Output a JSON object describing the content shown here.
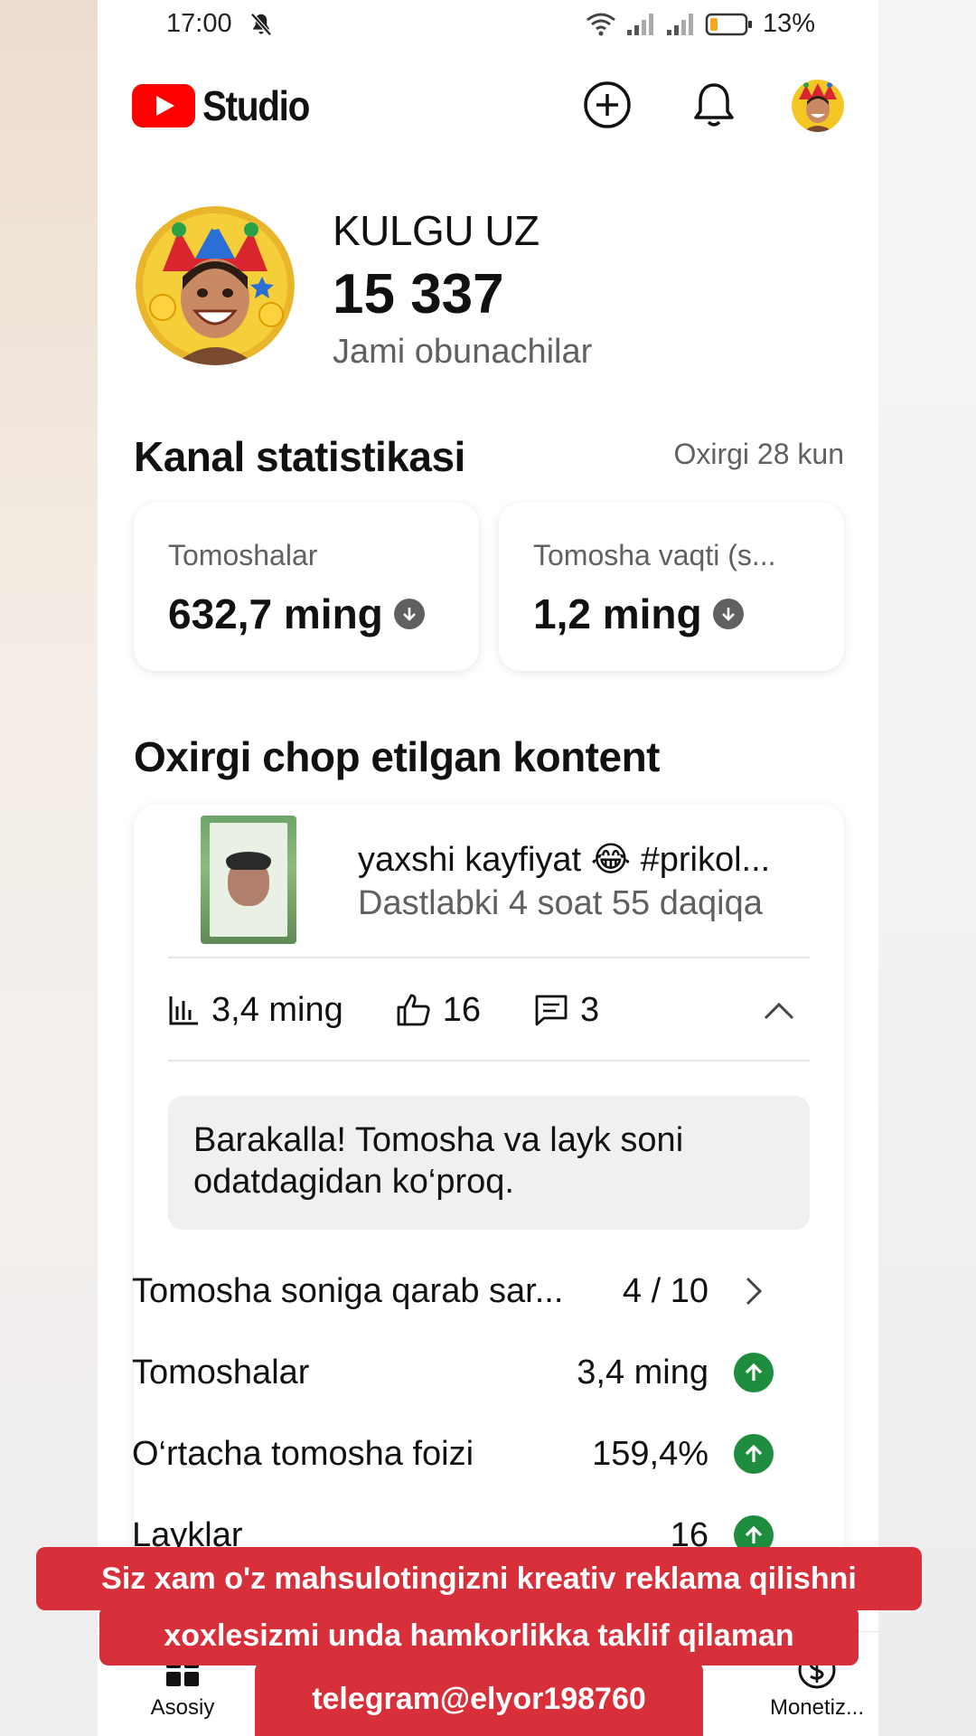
{
  "status_bar": {
    "time": "17:00",
    "battery_percent": "13%",
    "icons": [
      "mute-icon",
      "wifi-icon",
      "signal-icon",
      "signal-icon",
      "battery-icon"
    ]
  },
  "app_bar": {
    "logo_text": "Studio",
    "actions": [
      "create-icon",
      "bell-icon",
      "avatar"
    ]
  },
  "channel": {
    "name": "KULGU UZ",
    "subscribers": "15 337",
    "subscribers_label": "Jami obunachilar"
  },
  "stats": {
    "title": "Kanal statistikasi",
    "period": "Oxirgi 28 kun",
    "cards": [
      {
        "label": "Tomoshalar",
        "value": "632,7 ming",
        "trend": "down"
      },
      {
        "label": "Tomosha vaqti (s...",
        "value": "1,2 ming",
        "trend": "down"
      }
    ]
  },
  "latest": {
    "title": "Oxirgi chop etilgan kontent",
    "video": {
      "title": "yaxshi kayfiyat 😂 #prikol...",
      "subtitle": "Dastlabki 4 soat 55 daqiqa"
    },
    "metrics": {
      "views": "3,4 ming",
      "likes": "16",
      "comments": "3"
    },
    "insight": "Barakalla! Tomosha va layk soni odatdagidan ko‘proq.",
    "rows": [
      {
        "label": "Tomosha soniga qarab sar...",
        "value": "4 / 10",
        "icon": "chevron-right-icon"
      },
      {
        "label": "Tomoshalar",
        "value": "3,4 ming",
        "icon": "arrow-up-icon"
      },
      {
        "label": "O‘rtacha tomosha foizi",
        "value": "159,4%",
        "icon": "arrow-up-icon"
      },
      {
        "label": "Layklаr",
        "value": "16",
        "icon": "arrow-up-icon"
      }
    ]
  },
  "bottom_nav": {
    "items": [
      {
        "label": "Asosiy",
        "icon": "home-icon"
      },
      {
        "label": "Monetiz...",
        "icon": "dollar-icon"
      }
    ]
  },
  "overlay": {
    "line1": "Siz xam o'z mahsulotingizni kreativ reklama qilishni",
    "line2": "xoxlesizmi unda hamkorlikka taklif qilaman",
    "line3": "telegram@elyor198760"
  },
  "colors": {
    "brand_red": "#ff0000",
    "caption_red": "#d8303a",
    "positive_green": "#1e8e3e",
    "secondary_text": "#606060"
  }
}
